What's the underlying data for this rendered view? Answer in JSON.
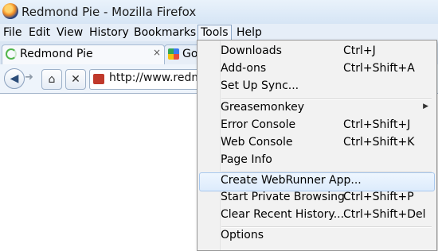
{
  "window": {
    "title": "Redmond Pie - Mozilla Firefox"
  },
  "menubar": [
    "File",
    "Edit",
    "View",
    "History",
    "Bookmarks",
    "Tools",
    "Help"
  ],
  "tabs": [
    {
      "label": "Redmond Pie",
      "close": "×"
    },
    {
      "label": "Goo"
    }
  ],
  "navbar": {
    "url": "http://www.redm"
  },
  "tools_menu": {
    "items": [
      {
        "label": "Downloads",
        "shortcut": "Ctrl+J"
      },
      {
        "label": "Add-ons",
        "shortcut": "Ctrl+Shift+A"
      },
      {
        "label": "Set Up Sync...",
        "shortcut": ""
      },
      {
        "label": "Greasemonkey",
        "shortcut": ""
      },
      {
        "label": "Error Console",
        "shortcut": "Ctrl+Shift+J"
      },
      {
        "label": "Web Console",
        "shortcut": "Ctrl+Shift+K"
      },
      {
        "label": "Page Info",
        "shortcut": ""
      },
      {
        "label": "Create WebRunner App...",
        "shortcut": ""
      },
      {
        "label": "Start Private Browsing",
        "shortcut": "Ctrl+Shift+P"
      },
      {
        "label": "Clear Recent History...",
        "shortcut": "Ctrl+Shift+Del"
      },
      {
        "label": "Options",
        "shortcut": ""
      }
    ]
  }
}
